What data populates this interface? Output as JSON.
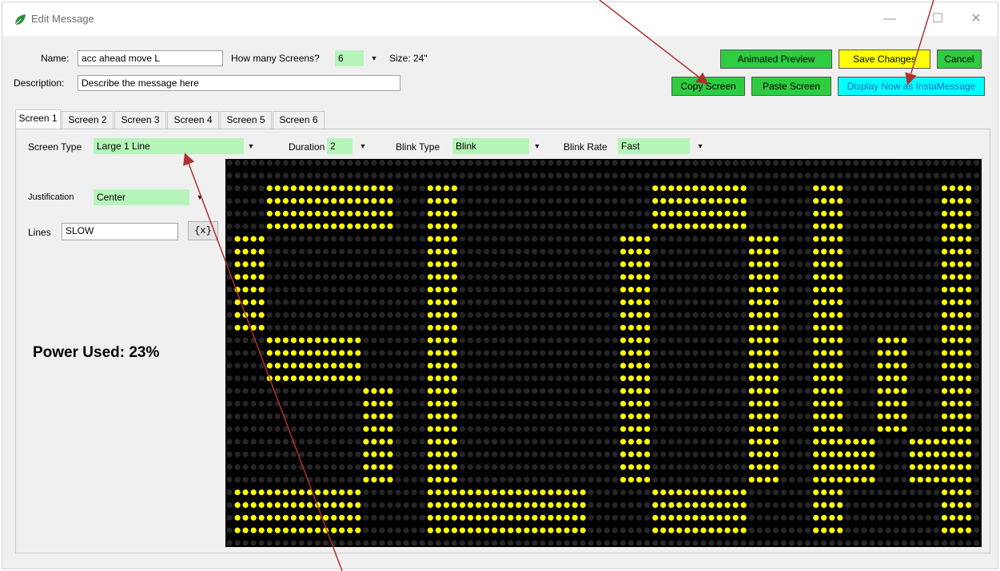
{
  "window": {
    "title": "Edit Message"
  },
  "form": {
    "name_label": "Name:",
    "name_value": "acc ahead move L",
    "screens_label": "How many Screens?",
    "screens_value": "6",
    "size_label": "Size:",
    "size_value": "24\"",
    "description_label": "Description:",
    "description_value": "Describe the message here"
  },
  "buttons": {
    "animated_preview": "Animated Preview",
    "save_changes": "Save Changes",
    "cancel": "Cancel",
    "copy_screen": "Copy Screen",
    "paste_screen": "Paste Screen",
    "display_now": "Display Now as InstaMessage"
  },
  "tabs": [
    "Screen 1",
    "Screen 2",
    "Screen 3",
    "Screen 4",
    "Screen 5",
    "Screen 6"
  ],
  "active_tab": "Screen 1",
  "screen_settings": {
    "screen_type_label": "Screen Type",
    "screen_type_value": "Large 1 Line",
    "duration_label": "Duration",
    "duration_value": "2",
    "blink_type_label": "Blink Type",
    "blink_type_value": "Blink",
    "blink_rate_label": "Blink Rate",
    "blink_rate_value": "Fast",
    "justification_label": "Justification",
    "justification_value": "Center",
    "lines_label": "Lines",
    "lines_value": "SLOW",
    "insert_var_label": "{x}"
  },
  "power_text": "Power Used: 23%",
  "led_display": {
    "text": "SLOW",
    "on_color": "#ffff00",
    "off_color": "#262626",
    "background": "#000000"
  },
  "colors": {
    "combo_bg": "#b6f5ba",
    "green_button": "#2ecc40",
    "yellow_button": "#ffff00",
    "cyan_button": "#00ffff",
    "annotation_arrow": "#b03030"
  }
}
